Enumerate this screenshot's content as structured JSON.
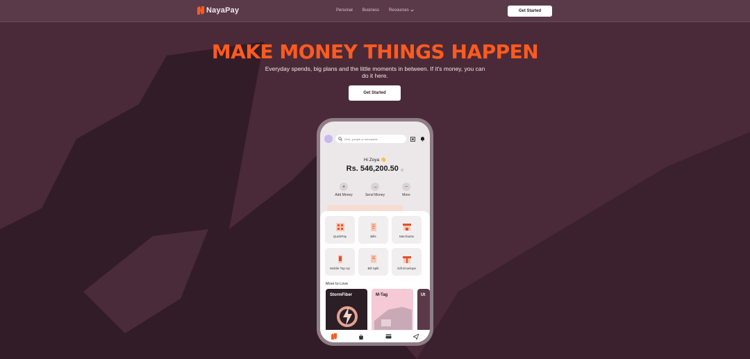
{
  "colors": {
    "accent": "#ff5a1f",
    "background": "#4a2a38",
    "nav_bg": "#5a3a48"
  },
  "brand": {
    "name": "NayaPay"
  },
  "nav": {
    "links": [
      {
        "label": "Personal"
      },
      {
        "label": "Business"
      },
      {
        "label": "Resources",
        "icon": "chevron-down-icon"
      }
    ],
    "cta_label": "Get Started"
  },
  "hero": {
    "title": "MAKE MONEY THINGS HAPPEN",
    "subtitle": "Everyday spends, big plans and the little moments in between. If it's money, you can do it here.",
    "cta_label": "Get Started"
  },
  "app": {
    "search_placeholder": "Find...people or merchants",
    "greeting": "Hi Zoya 👋",
    "balance": "Rs. 546,200.50",
    "quick_actions": [
      {
        "label": "Add Money",
        "icon": "plus-icon"
      },
      {
        "label": "Send Money",
        "icon": "arrow-right-icon"
      },
      {
        "label": "More",
        "icon": "minus-icon"
      }
    ],
    "tiles": [
      {
        "label": "QuickPay",
        "icon": "qr-icon"
      },
      {
        "label": "Bills",
        "icon": "bills-icon"
      },
      {
        "label": "Merchants",
        "icon": "storefront-icon"
      },
      {
        "label": "Mobile Top Up",
        "icon": "mobile-icon"
      },
      {
        "label": "Bill Split",
        "icon": "receipt-icon"
      },
      {
        "label": "Gift Envelope",
        "icon": "gift-icon"
      }
    ],
    "more_title": "More to Love",
    "cards": [
      {
        "title": "StormFiber"
      },
      {
        "title": "M-Tag"
      },
      {
        "title": "Ut"
      }
    ],
    "tabs": [
      "home-icon",
      "bag-icon",
      "card-icon",
      "send-icon"
    ]
  }
}
